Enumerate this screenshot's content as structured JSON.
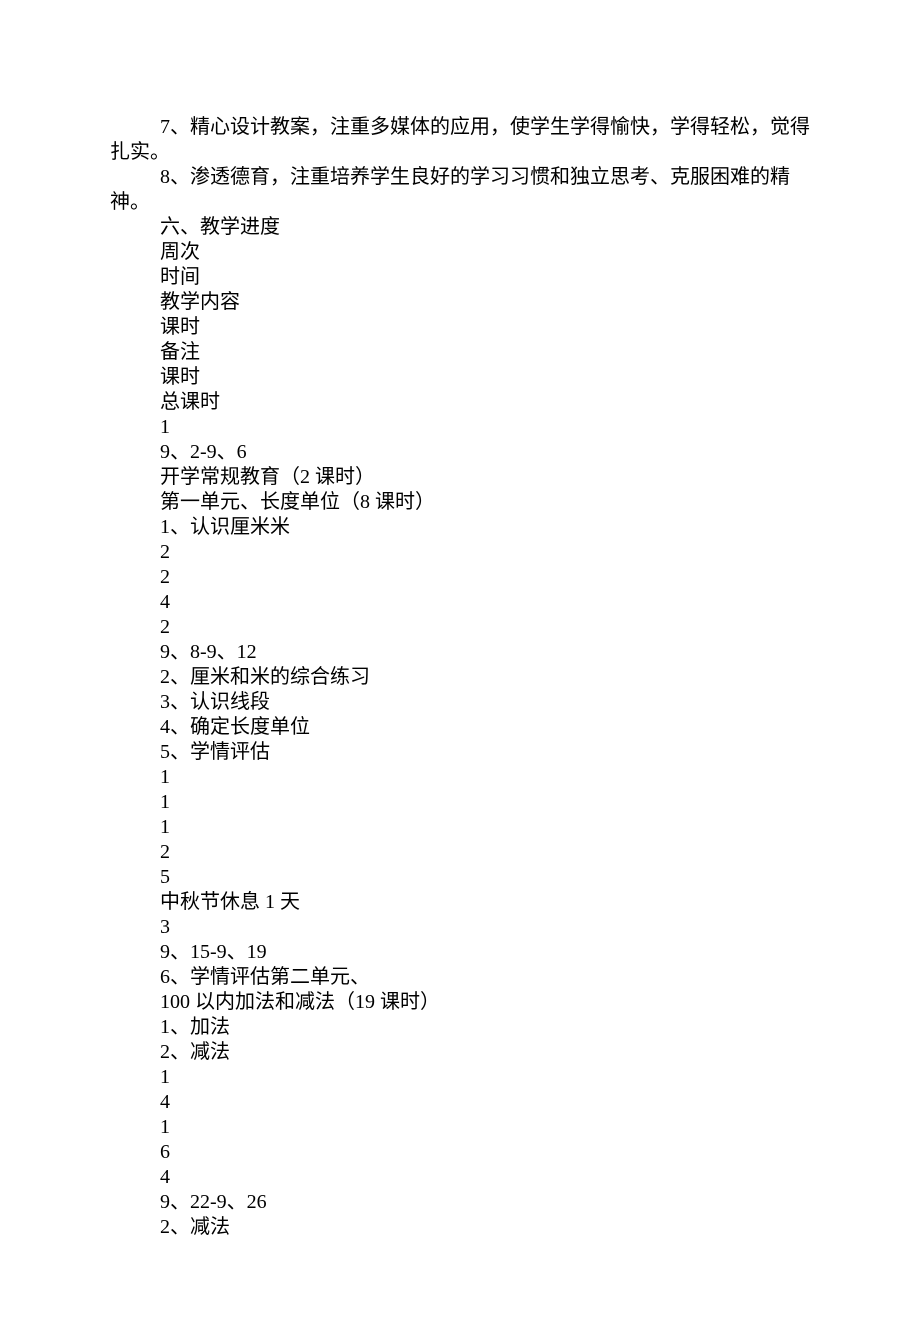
{
  "paragraphs": {
    "p7": "7、精心设计教案，注重多媒体的应用，使学生学得愉快，学得轻松，觉得扎实。",
    "p8": "8、渗透德育，注重培养学生良好的学习习惯和独立思考、克服困难的精神。"
  },
  "lines": [
    "六、教学进度",
    "周次",
    "时间",
    "教学内容",
    "课时",
    "备注",
    "课时",
    "总课时",
    "1",
    "9、2-9、6",
    "开学常规教育（2 课时）",
    "第一单元、长度单位（8 课时）",
    "1、认识厘米米",
    "2",
    "2",
    "4",
    "2",
    "9、8-9、12",
    "2、厘米和米的综合练习",
    "3、认识线段",
    "4、确定长度单位",
    "5、学情评估",
    "1",
    "1",
    "1",
    "2",
    "5",
    "中秋节休息 1 天",
    "3",
    "9、15-9、19",
    "6、学情评估第二单元、",
    "100 以内加法和减法（19 课时）",
    "1、加法",
    "2、减法",
    "1",
    "4",
    "1",
    "6",
    "4",
    "9、22-9、26",
    "2、减法"
  ]
}
